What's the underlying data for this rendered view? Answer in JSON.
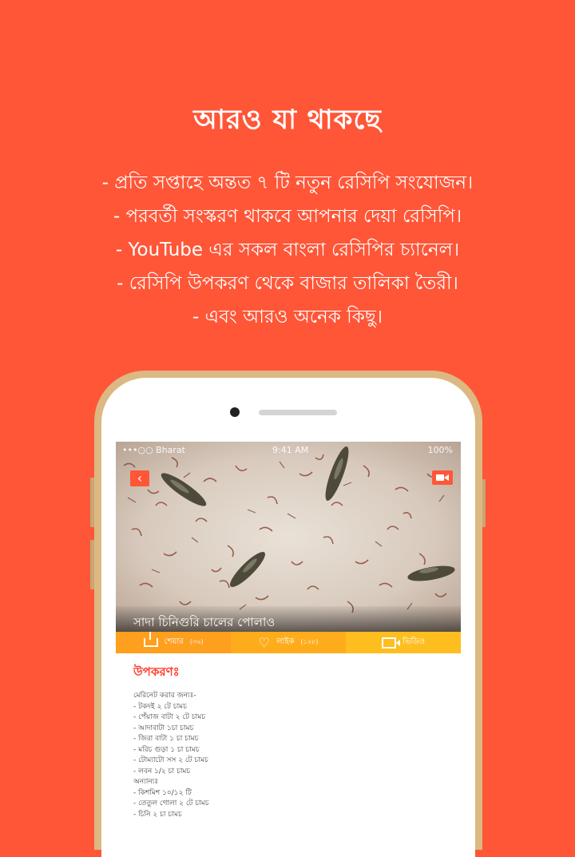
{
  "colors": {
    "background": "#ff5638",
    "phone_frame": "#dcb883",
    "action_bar": "#ffbe1f",
    "accent_red": "#ff3b2b"
  },
  "headline": "আরও যা থাকছে",
  "features": [
    "- প্রতি সপ্তাহে অন্তত ৭ টি নতুন রেসিপি সংযোজন।",
    "- পরবর্তী সংস্করণ থাকবে আপনার দেয়া রেসিপি।",
    "- YouTube এর সকল বাংলা রেসিপির চ্যানেল।",
    "- রেসিপি উপকরণ থেকে বাজার তালিকা তৈরী।",
    "- এবং আরও অনেক কিছু।"
  ],
  "status_bar": {
    "carrier": "•••○○ Bharat",
    "time": "9:41 AM",
    "battery": "100%"
  },
  "icons": {
    "back": "chevron-left-icon",
    "video": "video-camera-icon",
    "share": "share-icon",
    "like": "heart-icon",
    "video_action": "video-icon"
  },
  "recipe": {
    "title": "সাদা চিনিগুরি চালের পোলাও",
    "actions": {
      "share_label": "শেয়ার",
      "share_count": "(৩৬)",
      "like_label": "লাইক",
      "like_count": "(১২৮)",
      "video_label": "ভিডিও"
    },
    "ingredients_title": "উপকরণঃ",
    "ingredients": [
      "মেরিনেট করার জন্যঃ-",
      "- টকদই ২ টে চামচ",
      "- পেঁয়াজ বাটা ২ টে চামচ",
      "- আদাবাটা ১চা চামচ",
      "- জিরা বাটা ১ চা চামচ",
      "- মরিচ গুড়া ১ চা চামচ",
      "- টোম্যাটো সস ২ টে চামচ",
      "- লবন ১/২ চা চামচ",
      "অন্যান্যঃ",
      "- কিশমিশ ১০/১২ টি",
      "- তেতুল গোলা ২ টে চামচ",
      "- চিনি ২ চা চামচ"
    ]
  }
}
